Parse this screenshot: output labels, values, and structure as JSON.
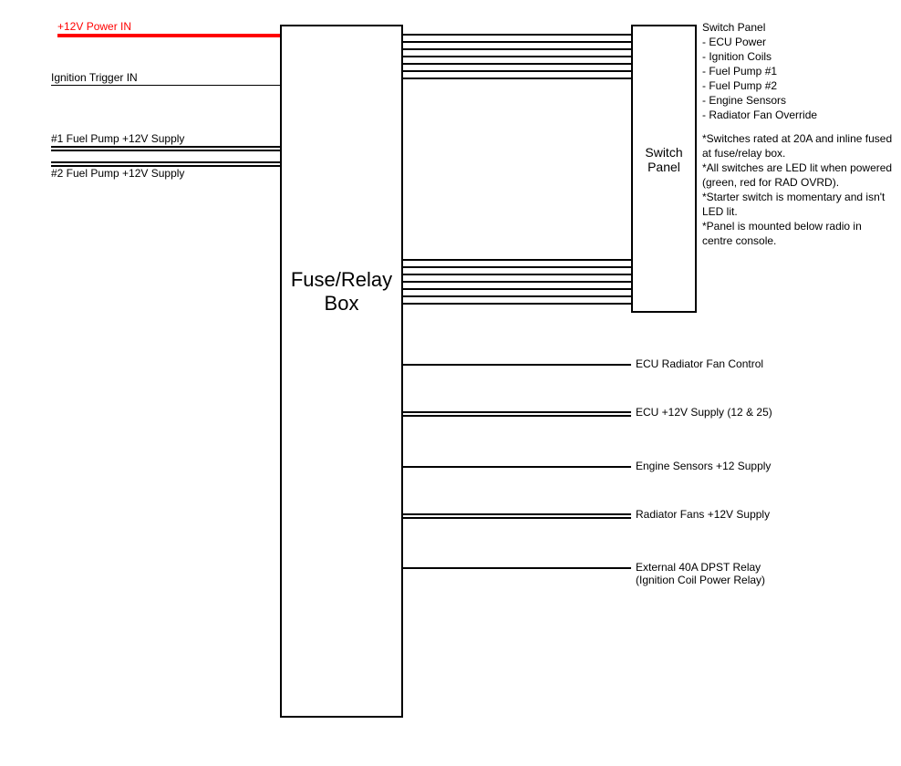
{
  "left_labels": {
    "power_in": "+12V Power IN",
    "ignition_trigger": "Ignition Trigger IN",
    "fuel_pump_1": "#1 Fuel Pump +12V Supply",
    "fuel_pump_2": "#2 Fuel Pump +12V Supply"
  },
  "main_box": {
    "title_line1": "Fuse/Relay",
    "title_line2": "Box"
  },
  "switch_panel": {
    "title_line1": "Switch",
    "title_line2": "Panel",
    "heading": "Switch Panel",
    "items": [
      "- ECU Power",
      "- Ignition Coils",
      "- Fuel Pump #1",
      "- Fuel Pump #2",
      "- Engine Sensors",
      "- Radiator Fan Override"
    ],
    "notes": [
      "*Switches rated at 20A and inline fused at fuse/relay box.",
      "*All switches are LED lit when powered (green, red for RAD OVRD).",
      "*Starter switch is momentary and isn't LED lit.",
      "*Panel is mounted below radio in centre console."
    ]
  },
  "right_outputs": {
    "ecu_rad_fan": "ECU Radiator Fan Control",
    "ecu_12v": "ECU +12V Supply (12 & 25)",
    "engine_sensors": "Engine Sensors +12 Supply",
    "rad_fans": "Radiator Fans +12V Supply",
    "ext_relay_line1": "External 40A DPST Relay",
    "ext_relay_line2": "(Ignition Coil Power Relay)"
  }
}
